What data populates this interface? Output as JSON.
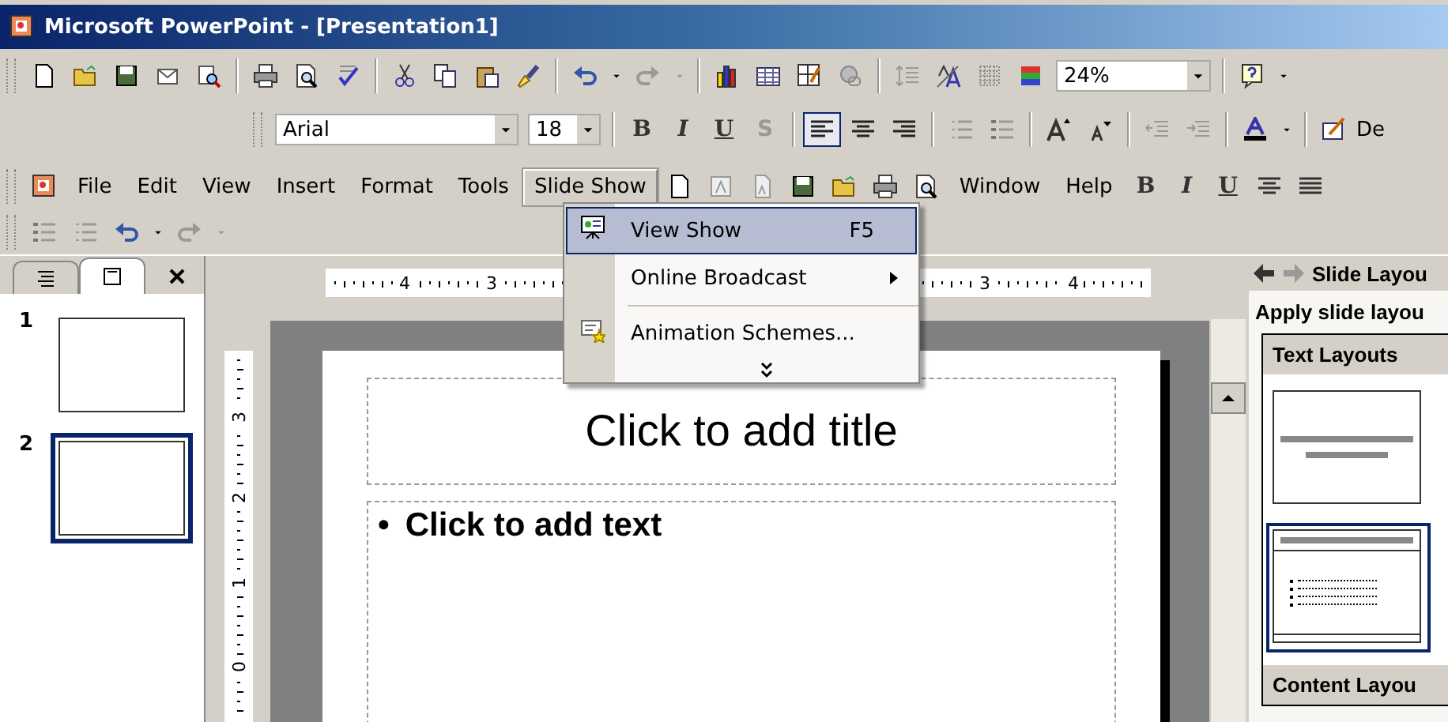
{
  "window": {
    "title": "Microsoft PowerPoint - [Presentation1]"
  },
  "standard_toolbar": {
    "zoom": "24%"
  },
  "formatting_toolbar": {
    "font": "Arial",
    "size": "18",
    "style_buttons": [
      {
        "label": "B",
        "kind": "bold"
      },
      {
        "label": "I",
        "kind": "italic"
      },
      {
        "label": "U",
        "kind": "underline"
      },
      {
        "label": "S",
        "kind": "shadow"
      }
    ],
    "alignment_buttons": [
      {
        "kind": "left",
        "selected": true
      },
      {
        "kind": "center",
        "selected": false
      },
      {
        "kind": "right",
        "selected": false
      }
    ],
    "design_label": "De"
  },
  "menu_bar": {
    "items": [
      {
        "label": "File",
        "selected": false
      },
      {
        "label": "Edit",
        "selected": false
      },
      {
        "label": "View",
        "selected": false
      },
      {
        "label": "Insert",
        "selected": false
      },
      {
        "label": "Format",
        "selected": false
      },
      {
        "label": "Tools",
        "selected": false
      },
      {
        "label": "Slide Show",
        "selected": true
      },
      {
        "label": "Window",
        "selected": false
      },
      {
        "label": "Help",
        "selected": false
      }
    ],
    "style_buttons": [
      {
        "label": "B",
        "kind": "bold"
      },
      {
        "label": "I",
        "kind": "italic"
      },
      {
        "label": "U",
        "kind": "underline"
      }
    ]
  },
  "menu": {
    "items": [
      {
        "label": "View Show",
        "shortcut": "F5",
        "kind": "command",
        "selected": true
      },
      {
        "label": "Online Broadcast",
        "kind": "submenu",
        "selected": false
      },
      {
        "label": "Animation Schemes...",
        "kind": "command",
        "selected": false
      }
    ]
  },
  "outline_pane": {
    "tabs": [
      {
        "kind": "outline",
        "selected": false
      },
      {
        "kind": "slides",
        "selected": true
      }
    ],
    "slides": [
      {
        "number": "1",
        "selected": false
      },
      {
        "number": "2",
        "selected": true
      }
    ]
  },
  "rulers": {
    "horizontal": [
      "4",
      "3",
      "3",
      "4"
    ],
    "vertical": [
      "3",
      "2",
      "1",
      "0"
    ]
  },
  "slide": {
    "title_placeholder": "Click to add title",
    "bullet": "•",
    "body_placeholder": "Click to add text"
  },
  "task_pane": {
    "title": "Slide Layou",
    "subtitle": "Apply slide layou",
    "sections": [
      "Text Layouts",
      "Content Layou"
    ],
    "layouts": [
      {
        "kind": "title",
        "selected": false
      },
      {
        "kind": "title-text",
        "selected": true
      }
    ]
  }
}
